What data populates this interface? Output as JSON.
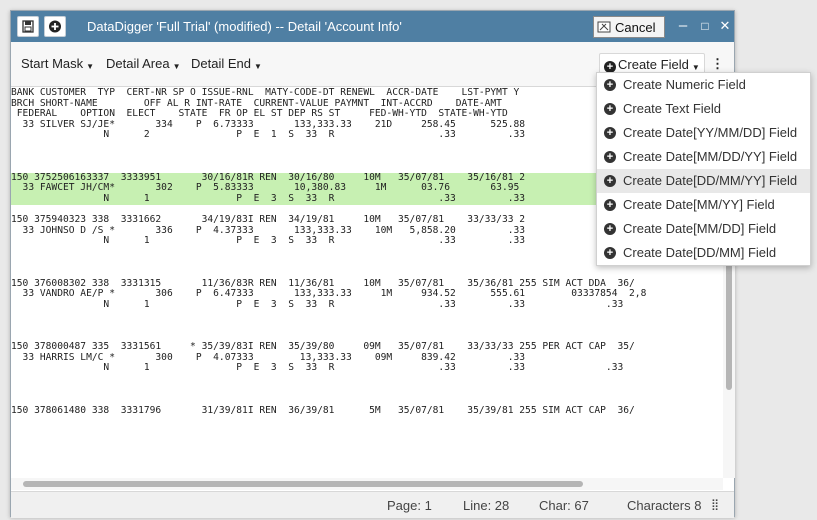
{
  "window": {
    "title": "DataDigger  'Full Trial' (modified) -- Detail  'Account Info'",
    "cancel_label": "Cancel",
    "minimize_label": "–",
    "maximize_label": "□",
    "close_label": "✕"
  },
  "toolbar": {
    "start_mask": "Start Mask",
    "detail_area": "Detail Area",
    "detail_end": "Detail End",
    "create_field": "Create Field",
    "more": "⋮"
  },
  "header_lines": [
    "BANK CUSTOMER  TYP  CERT-NR SP O ISSUE-RNL  MATY-CODE-DT RENEWL  ACCR-DATE    LST-PYMT Y",
    "BRCH SHORT-NAME        OFF AL R INT-RATE  CURRENT-VALUE PAYMNT  INT-ACCRD    DATE-AMT",
    " FEDERAL    OPTION  ELECT    STATE  FR OP EL ST DEP RS ST     FED-WH-YTD  STATE-WH-YTD"
  ],
  "records": [
    {
      "lines": [
        "  33 SILVER SJ/JE*       334    P  6.73333       133,333.33    21D     258.45      525.88",
        "                N      2               P  E  1  S  33  R                  .33         .33",
        "",
        ""
      ]
    },
    {
      "highlight": "green",
      "lines_green": [
        "150 3752506163337  3333951       30/16/81R REN  30/16/80     10M   35/07/81    35/16/81 2",
        "  33 FAWCET JH/CM*       302    P  5.83333       10,380.83     1M      03.76       63.95",
        "                N      1               P  E  3  S  33  R                  .33         .33"
      ]
    },
    {
      "lines": [
        "",
        "150 375940323 338  3331662       34/19/83I REN  34/19/81     10M   35/07/81    33/33/33 2",
        "  33 JOHNSO D /S *       336    P  4.37333       133,333.33    10M   5,858.20         .33",
        "                N      1               P  E  3  S  33  R                  .33         .33              .33",
        "",
        "",
        "",
        "150 376008302 338  3331315       11/36/83R REN  11/36/81     10M   35/07/81    35/36/81 255 SIM ACT DDA  36/",
        "  33 VANDRO AE/P *       306    P  6.47333       133,333.33     1M     934.52      555.61        03337854  2,8",
        "                N      1               P  E  3  S  33  R                  .33         .33              .33",
        "",
        "",
        "",
        "150 378000487 335  3331561     * 35/39/83I REN  35/39/80     09M   35/07/81    33/33/33 255 PER ACT CAP  35/",
        "  33 HARRIS LM/C *       300    P  4.07333        13,333.33    09M     839.42         .33",
        "                N      1               P  E  3  S  33  R                  .33         .33              .33",
        "",
        "",
        "",
        "150 378061480 338  3331796       31/39/81I REN  36/39/81      5M   35/07/81    35/39/81 255 SIM ACT CAP  36/"
      ]
    }
  ],
  "menu": {
    "items": [
      "Create Numeric Field",
      "Create Text Field",
      "Create Date[YY/MM/DD] Field",
      "Create Date[MM/DD/YY] Field",
      "Create Date[DD/MM/YY] Field",
      "Create Date[MM/YY] Field",
      "Create Date[MM/DD] Field",
      "Create Date[DD/MM] Field"
    ],
    "hover_index": 4
  },
  "status": {
    "page": "Page: 1",
    "line": "Line: 28",
    "char": "Char: 67",
    "characters": "Characters 8"
  },
  "colors": {
    "titlebar": "#4f7fa3",
    "record_highlight": "#c7f0b2",
    "column_highlight": "#aed7f4",
    "selection": "#6a4fc0"
  }
}
